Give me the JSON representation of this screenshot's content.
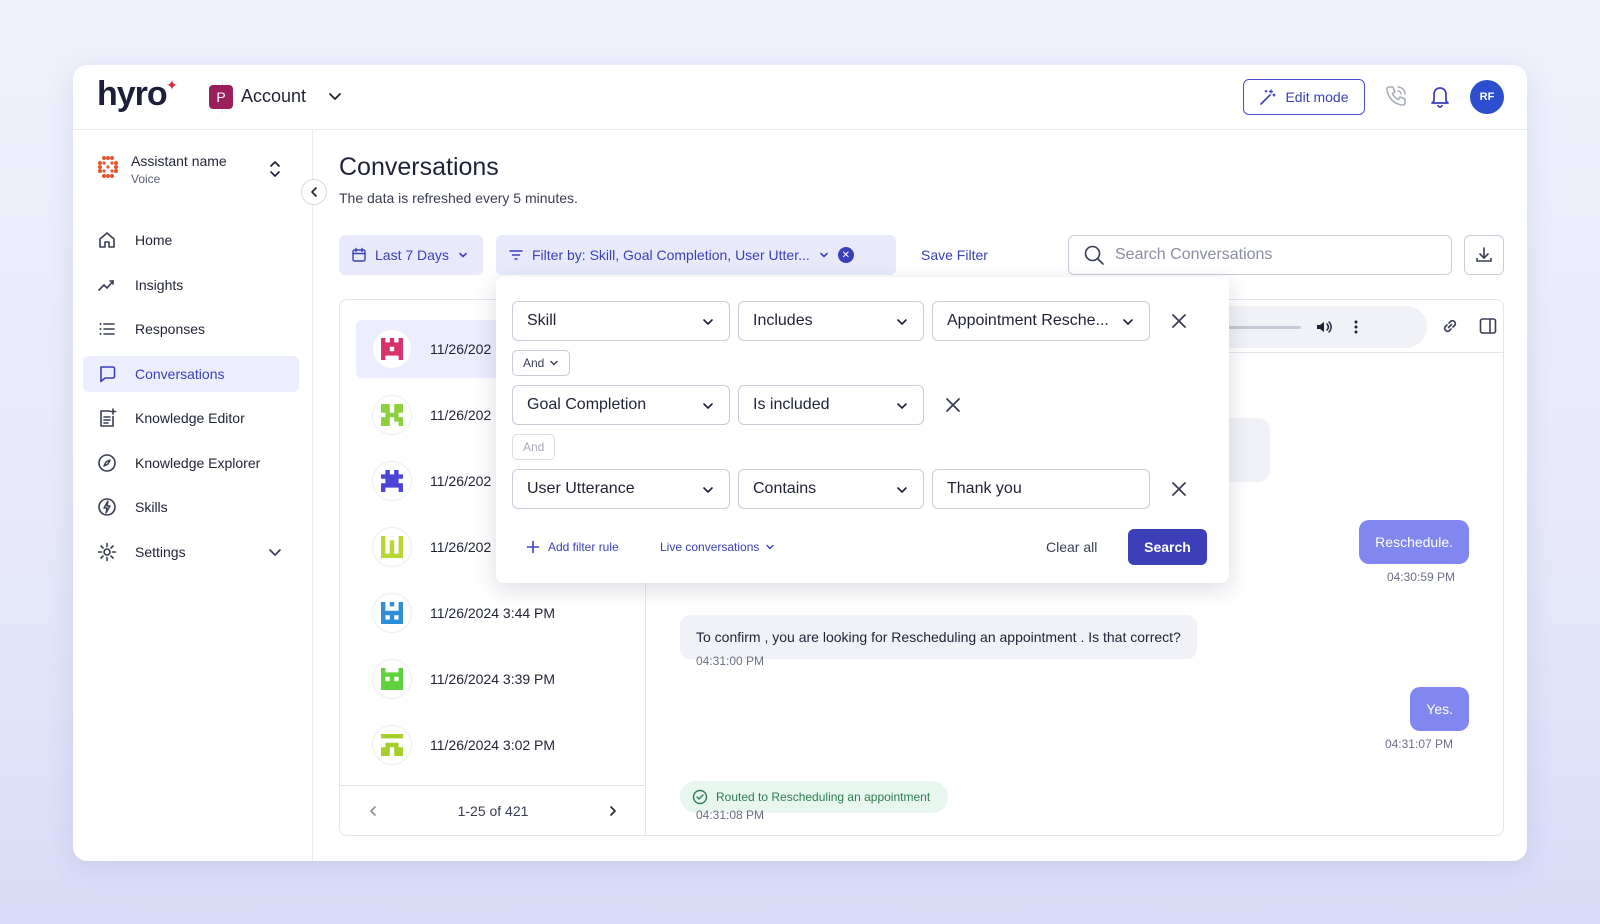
{
  "header": {
    "logo": "hyro",
    "account_badge": "P",
    "account_name": "Account",
    "edit_mode_label": "Edit mode",
    "avatar_initials": "RF",
    "colors": {
      "accent": "#3b40b8",
      "account_badge": "#9b1f5c",
      "avatar": "#2c4ecf"
    }
  },
  "sidebar": {
    "assistant_name": "Assistant name",
    "assistant_type": "Voice",
    "items": [
      {
        "label": "Home",
        "icon": "home-icon"
      },
      {
        "label": "Insights",
        "icon": "insights-icon"
      },
      {
        "label": "Responses",
        "icon": "list-icon"
      },
      {
        "label": "Conversations",
        "icon": "chat-icon",
        "active": true
      },
      {
        "label": "Knowledge Editor",
        "icon": "knowledge-editor-icon"
      },
      {
        "label": "Knowledge Explorer",
        "icon": "compass-icon"
      },
      {
        "label": "Skills",
        "icon": "bolt-icon"
      },
      {
        "label": "Settings",
        "icon": "gear-icon"
      }
    ]
  },
  "main": {
    "title": "Conversations",
    "subtitle": "The data is refreshed every 5 minutes.",
    "date_filter": "Last 7 Days",
    "filter_summary": "Filter by: Skill, Goal Completion, User Utter...",
    "save_filter": "Save Filter",
    "search_placeholder": "Search Conversations"
  },
  "conversations": {
    "items": [
      {
        "time": "11/26/202",
        "color": "#d6336c",
        "active": true
      },
      {
        "time": "11/26/202",
        "color": "#8bd13d"
      },
      {
        "time": "11/26/202",
        "color": "#4b44d6"
      },
      {
        "time": "11/26/202",
        "color": "#b9d637"
      },
      {
        "time": "11/26/2024 3:44 PM",
        "color": "#2f8fd6"
      },
      {
        "time": "11/26/2024 3:39 PM",
        "color": "#5fd13d"
      },
      {
        "time": "11/26/2024 3:02 PM",
        "color": "#a6cf2e"
      }
    ],
    "pagination": "1-25 of 421"
  },
  "chat": {
    "messages": [
      {
        "role": "user",
        "text": "Reschedule.",
        "time": "04:30:59 PM"
      },
      {
        "role": "bot",
        "text": "To confirm , you are looking for Rescheduling an appointment . Is that correct?",
        "time": "04:31:00 PM"
      },
      {
        "role": "user",
        "text": "Yes.",
        "time": "04:31:07 PM"
      }
    ],
    "routed": {
      "text": "Routed to Rescheduling an appointment",
      "time": "04:31:08 PM"
    }
  },
  "filter_panel": {
    "rules": [
      {
        "field": "Skill",
        "operator": "Includes",
        "value": "Appointment Resche..."
      },
      {
        "field": "Goal Completion",
        "operator": "Is included"
      },
      {
        "field": "User Utterance",
        "operator": "Contains",
        "value": "Thank you"
      }
    ],
    "connectors": [
      "And",
      "And"
    ],
    "add_rule": "Add filter rule",
    "scope": "Live conversations",
    "clear_all": "Clear all",
    "search": "Search"
  }
}
